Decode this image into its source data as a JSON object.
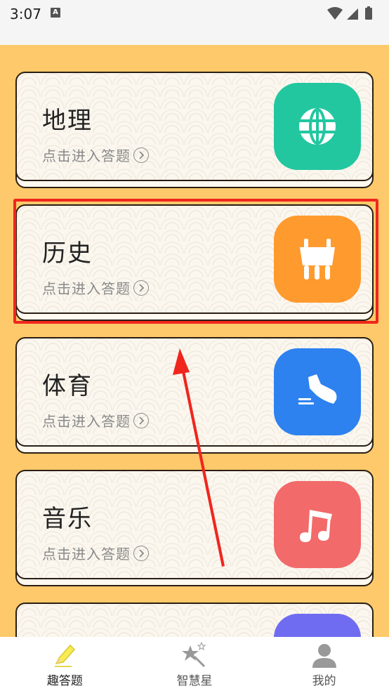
{
  "status_bar": {
    "time": "3:07",
    "notification_letter": "A",
    "icons": [
      "wifi-icon",
      "signal-icon",
      "battery-icon"
    ]
  },
  "categories": [
    {
      "title": "地理",
      "subtitle": "点击进入答题",
      "icon": "globe-icon",
      "color": "#22c7a0"
    },
    {
      "title": "历史",
      "subtitle": "点击进入答题",
      "icon": "bronze-ding-icon",
      "color": "#ff9a2e"
    },
    {
      "title": "体育",
      "subtitle": "点击进入答题",
      "icon": "sneaker-icon",
      "color": "#2d82f0"
    },
    {
      "title": "音乐",
      "subtitle": "点击进入答题",
      "icon": "music-note-icon",
      "color": "#f26a6a"
    },
    {
      "title": "",
      "subtitle": "",
      "icon": "partial-icon",
      "color": "#6f6cf2"
    }
  ],
  "bottom_nav": [
    {
      "label": "趣答题",
      "icon": "pencil-icon",
      "active": true
    },
    {
      "label": "智慧星",
      "icon": "magic-star-icon",
      "active": false
    },
    {
      "label": "我的",
      "icon": "person-icon",
      "active": false
    }
  ],
  "colors": {
    "background": "#fdc96a",
    "highlight": "#f0261e",
    "card_border": "#2b1e14"
  }
}
